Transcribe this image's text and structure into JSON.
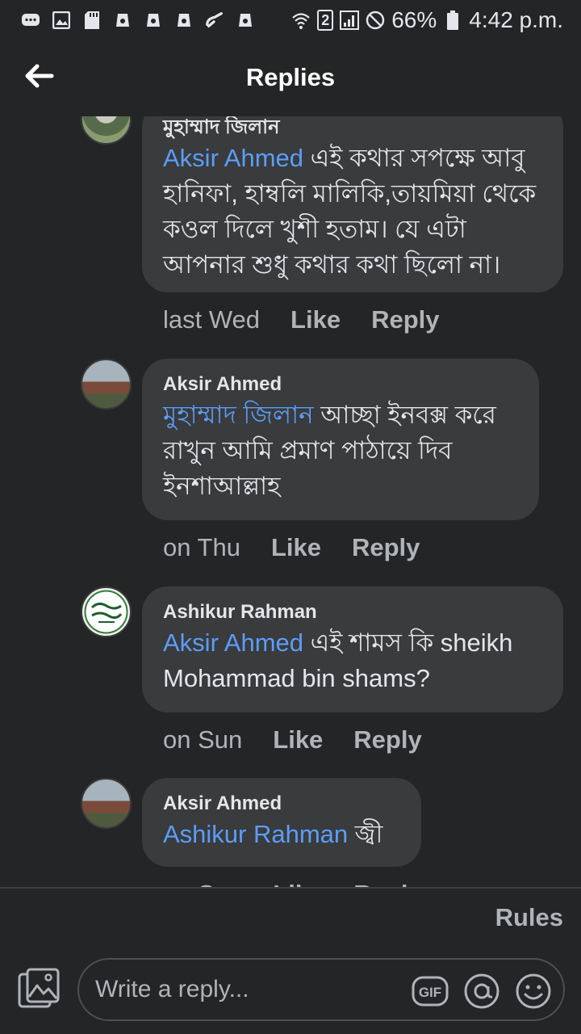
{
  "status_bar": {
    "battery": "66%",
    "time": "4:42 p.m.",
    "sim_slot": "2"
  },
  "header": {
    "title": "Replies",
    "back_icon": "back-arrow-icon"
  },
  "comments": [
    {
      "author": "মুহাম্মাদ জিলান",
      "mention": "Aksir Ahmed",
      "text": " এই কথার সপক্ষে আবু হানিফা, হাম্বলি মালিকি,তায়মিয়া থেকে কওল দিলে খুশী হতাম। যে এটা আপনার শুধু কথার কথা ছিলো না।",
      "time": "last Wed",
      "like": "Like",
      "reply": "Reply"
    },
    {
      "author": "Aksir Ahmed",
      "mention": "মুহাম্মাদ জিলান",
      "text": " আচ্ছা ইনবক্স করে রাখুন আমি প্রমাণ পাঠায়ে দিব ইনশাআল্লাহ",
      "time": "on Thu",
      "like": "Like",
      "reply": "Reply"
    },
    {
      "author": "Ashikur Rahman",
      "mention": "Aksir Ahmed",
      "text": " এই শামস কি sheikh Mohammad bin shams?",
      "time": "on Sun",
      "like": "Like",
      "reply": "Reply"
    },
    {
      "author": "Aksir Ahmed",
      "mention": "Ashikur Rahman",
      "text": " জ্বী",
      "time": "on Sun",
      "like": "Like",
      "reply": "Reply"
    }
  ],
  "composer": {
    "rules_label": "Rules",
    "placeholder": "Write a reply...",
    "gif_label": "GIF"
  },
  "colors": {
    "background": "#242526",
    "bubble": "#3a3b3c",
    "mention": "#5b9df9",
    "muted_text": "#b0b3b8"
  }
}
